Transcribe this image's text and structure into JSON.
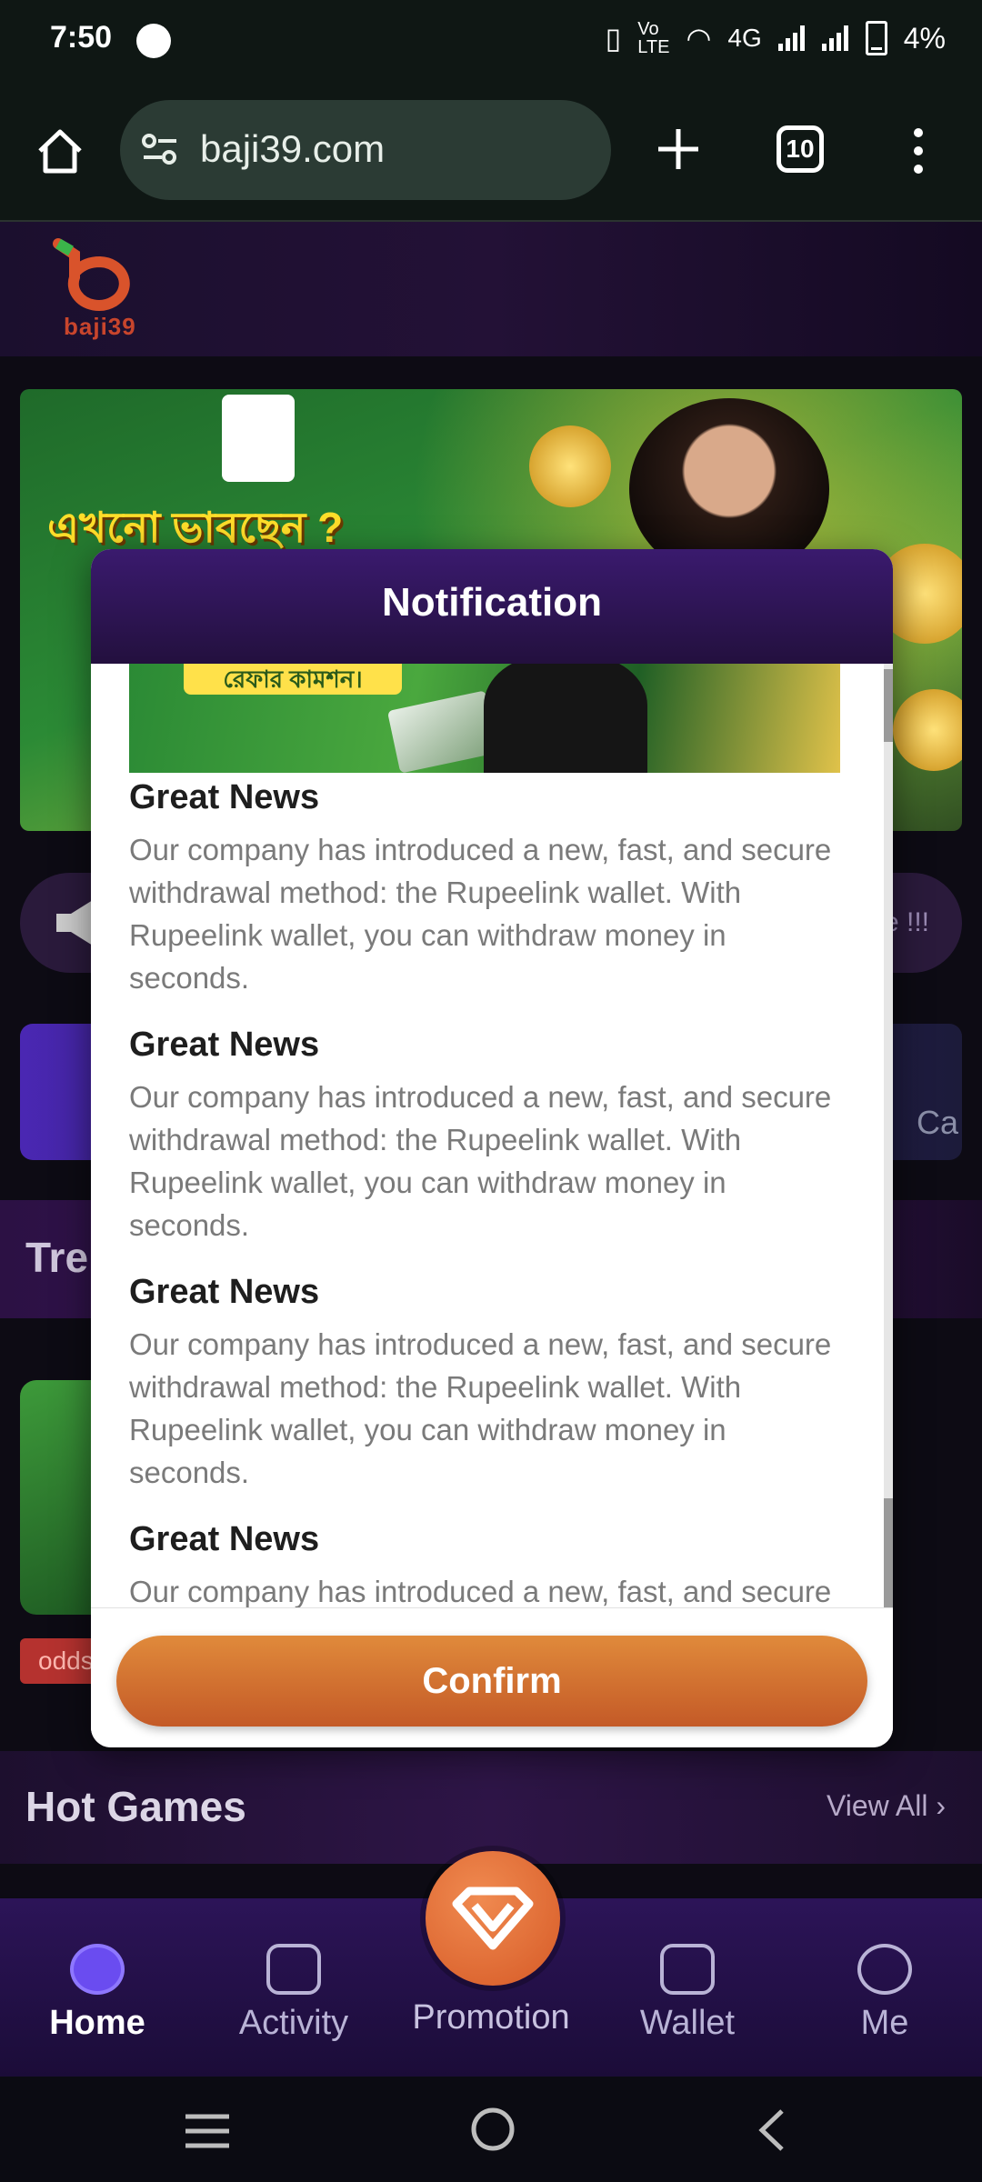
{
  "status_bar": {
    "time": "7:50",
    "network": "4G",
    "battery": "4%"
  },
  "browser": {
    "url": "baji39.com",
    "tab_count": "10"
  },
  "site": {
    "logo_text": "baji39",
    "banner_title": "এখনো ভাবছেন ?",
    "marquee_tail": "e !!!",
    "cards_tail": "Ca",
    "trending_title": "Trer",
    "odds_tag": "odds",
    "hot_games_title": "Hot Games",
    "view_all": "View All ›"
  },
  "modal": {
    "title": "Notification",
    "image_tag": "রেফার কামশন।",
    "news": [
      {
        "title": "Great News",
        "body": "Our company has introduced a new, fast, and secure withdrawal method: the Rupeelink wallet. With Rupeelink wallet, you can withdraw money in seconds."
      },
      {
        "title": "Great News",
        "body": "Our company has introduced a new, fast, and secure withdrawal method: the Rupeelink wallet. With Rupeelink wallet, you can withdraw money in seconds."
      },
      {
        "title": "Great News",
        "body": "Our company has introduced a new, fast, and secure withdrawal method: the Rupeelink wallet. With Rupeelink wallet, you can withdraw money in seconds."
      },
      {
        "title": "Great News",
        "body": "Our company has introduced a new, fast, and secure"
      }
    ],
    "confirm_label": "Confirm"
  },
  "bottom_nav": {
    "home": "Home",
    "activity": "Activity",
    "promotion": "Promotion",
    "wallet": "Wallet",
    "me": "Me"
  },
  "colors": {
    "accent_purple": "#3a1a6e",
    "confirm_orange": "#d06a2f",
    "home_active": "#6a4cf0"
  }
}
